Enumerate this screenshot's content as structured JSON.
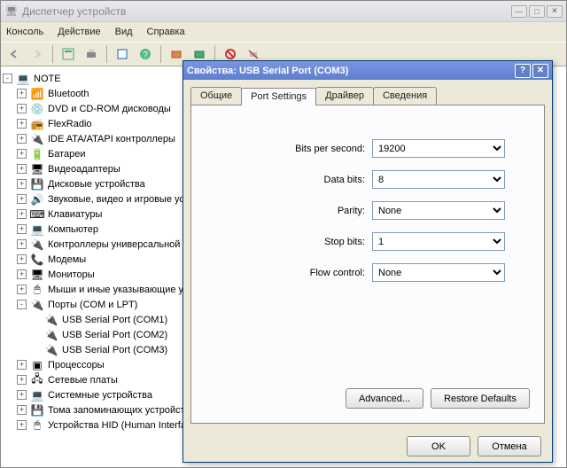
{
  "window": {
    "title": "Диспетчер устройств"
  },
  "menu": {
    "console": "Консоль",
    "action": "Действие",
    "view": "Вид",
    "help": "Справка"
  },
  "tree": {
    "root": "NOTE",
    "nodes": [
      {
        "label": "Bluetooth",
        "icon": "📶"
      },
      {
        "label": "DVD и CD-ROM дисководы",
        "icon": "💿"
      },
      {
        "label": "FlexRadio",
        "icon": "📻"
      },
      {
        "label": "IDE ATA/ATAPI контроллеры",
        "icon": "🔌"
      },
      {
        "label": "Батареи",
        "icon": "🔋"
      },
      {
        "label": "Видеоадаптеры",
        "icon": "🖥"
      },
      {
        "label": "Дисковые устройства",
        "icon": "💾"
      },
      {
        "label": "Звуковые, видео и игровые устройства",
        "icon": "🔊"
      },
      {
        "label": "Клавиатуры",
        "icon": "⌨"
      },
      {
        "label": "Компьютер",
        "icon": "💻"
      },
      {
        "label": "Контроллеры универсальной последовательной шины",
        "icon": "🔌"
      },
      {
        "label": "Модемы",
        "icon": "📞"
      },
      {
        "label": "Мониторы",
        "icon": "🖥"
      },
      {
        "label": "Мыши и иные указывающие устройства",
        "icon": "🖱"
      },
      {
        "label": "Порты (COM и LPT)",
        "icon": "🔌",
        "expanded": true,
        "children": [
          {
            "label": "USB Serial Port (COM1)"
          },
          {
            "label": "USB Serial Port (COM2)"
          },
          {
            "label": "USB Serial Port (COM3)"
          }
        ]
      },
      {
        "label": "Процессоры",
        "icon": "▣"
      },
      {
        "label": "Сетевые платы",
        "icon": "🖧"
      },
      {
        "label": "Системные устройства",
        "icon": "💻"
      },
      {
        "label": "Тома запоминающих устройств",
        "icon": "💾"
      },
      {
        "label": "Устройства HID (Human Interface Devices)",
        "icon": "🖱"
      }
    ]
  },
  "dialog": {
    "title": "Свойства: USB Serial Port (COM3)",
    "tabs": {
      "general": "Общие",
      "port_settings": "Port Settings",
      "driver": "Драйвер",
      "details": "Сведения"
    },
    "fields": {
      "bits_per_second": {
        "label": "Bits per second:",
        "value": "19200"
      },
      "data_bits": {
        "label": "Data bits:",
        "value": "8"
      },
      "parity": {
        "label": "Parity:",
        "value": "None"
      },
      "stop_bits": {
        "label": "Stop bits:",
        "value": "1"
      },
      "flow_control": {
        "label": "Flow control:",
        "value": "None"
      }
    },
    "buttons": {
      "advanced": "Advanced...",
      "restore": "Restore Defaults",
      "ok": "OK",
      "cancel": "Отмена"
    }
  }
}
